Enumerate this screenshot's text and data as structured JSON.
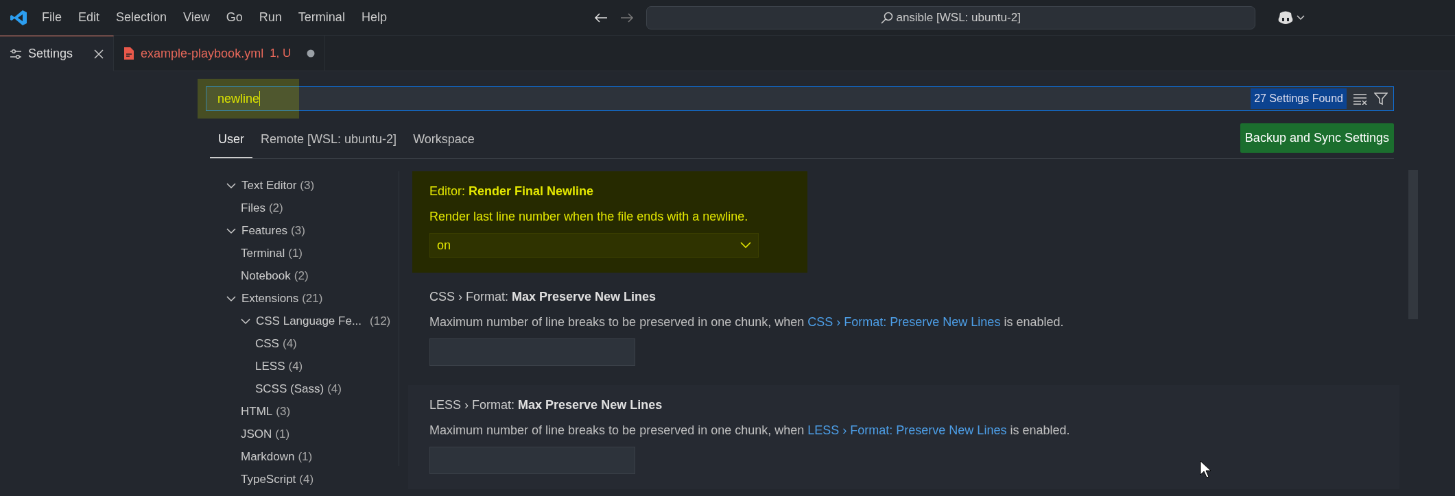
{
  "title_bar": {
    "menu": [
      "File",
      "Edit",
      "Selection",
      "View",
      "Go",
      "Run",
      "Terminal",
      "Help"
    ],
    "command_center": "ansible [WSL: ubuntu-2]"
  },
  "editor_tabs": [
    {
      "kind": "settings",
      "label": "Settings",
      "selected": true
    },
    {
      "kind": "file",
      "label": "example-playbook.yml",
      "status": "1, U",
      "dirty": true,
      "selected": false
    }
  ],
  "search": {
    "value": "newline",
    "highlighted": true,
    "result_count": "27 Settings Found"
  },
  "scope_tabs": [
    {
      "label": "User",
      "selected": true
    },
    {
      "label": "Remote [WSL: ubuntu-2]",
      "selected": false
    },
    {
      "label": "Workspace",
      "selected": false
    }
  ],
  "sync_button": "Backup and Sync Settings",
  "toc": [
    {
      "label": "Text Editor",
      "count": "(3)",
      "expanded": true,
      "children": [
        {
          "label": "Files",
          "count": "(2)"
        }
      ]
    },
    {
      "label": "Features",
      "count": "(3)",
      "expanded": true,
      "children": [
        {
          "label": "Terminal",
          "count": "(1)"
        },
        {
          "label": "Notebook",
          "count": "(2)"
        }
      ]
    },
    {
      "label": "Extensions",
      "count": "(21)",
      "expanded": true,
      "children": [
        {
          "label": "CSS Language Fe...",
          "count": "(12)",
          "expanded": true,
          "children": [
            {
              "label": "CSS",
              "count": "(4)"
            },
            {
              "label": "LESS",
              "count": "(4)"
            },
            {
              "label": "SCSS (Sass)",
              "count": "(4)"
            }
          ]
        },
        {
          "label": "HTML",
          "count": "(3)"
        },
        {
          "label": "JSON",
          "count": "(1)"
        },
        {
          "label": "Markdown",
          "count": "(1)"
        },
        {
          "label": "TypeScript",
          "count": "(4)"
        }
      ]
    }
  ],
  "settings": [
    {
      "kind": "dropdown",
      "category": "Editor: ",
      "name": "Render Final Newline",
      "description": "Render last line number when the file ends with a newline.",
      "value": "on",
      "highlighted": true,
      "hovered": false
    },
    {
      "kind": "number",
      "category": "CSS › Format: ",
      "name": "Max Preserve New Lines",
      "description": "Maximum number of line breaks to be preserved in one chunk, when ",
      "link": "CSS › Format: Preserve New Lines",
      "description_end": " is enabled.",
      "highlighted": false,
      "hovered": false
    },
    {
      "kind": "number",
      "category": "LESS › Format: ",
      "name": "Max Preserve New Lines",
      "description": "Maximum number of line breaks to be preserved in one chunk, when ",
      "link": "LESS › Format: Preserve New Lines",
      "description_end": " is enabled.",
      "highlighted": false,
      "hovered": true
    }
  ]
}
